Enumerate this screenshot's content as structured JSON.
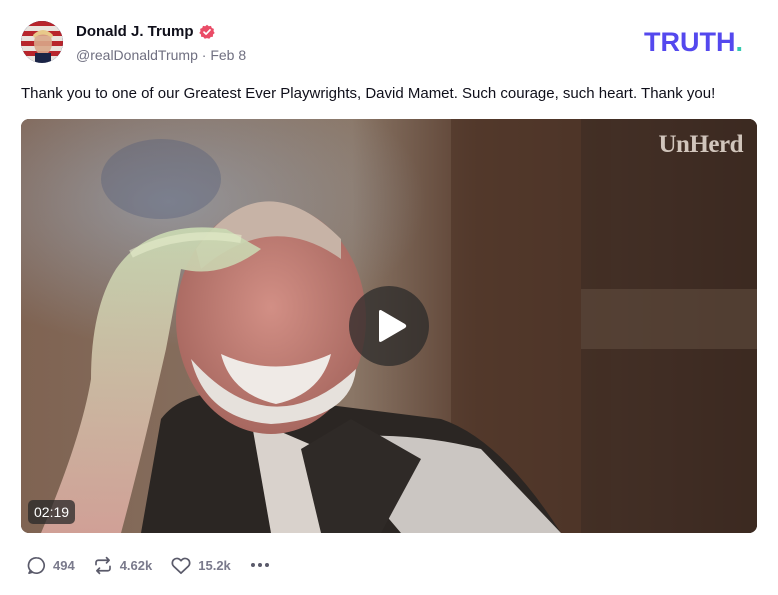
{
  "author": {
    "name": "Donald J. Trump",
    "handle": "@realDonaldTrump",
    "separator": " · ",
    "date": "Feb 8",
    "verified": true
  },
  "brand": {
    "wordmark": "TRUTH",
    "dot": ".",
    "color": "#5448ee",
    "dot_color": "#33c9b0"
  },
  "post": {
    "text": "Thank you to one of our Greatest Ever Playwrights, David Mamet. Such courage, such heart. Thank you!"
  },
  "video": {
    "watermark": "UnHerd",
    "duration": "02:19",
    "play_icon": "play-icon"
  },
  "actions": {
    "replies": "494",
    "retruths": "4.62k",
    "likes": "15.2k",
    "more_icon": "more-horizontal-icon"
  }
}
